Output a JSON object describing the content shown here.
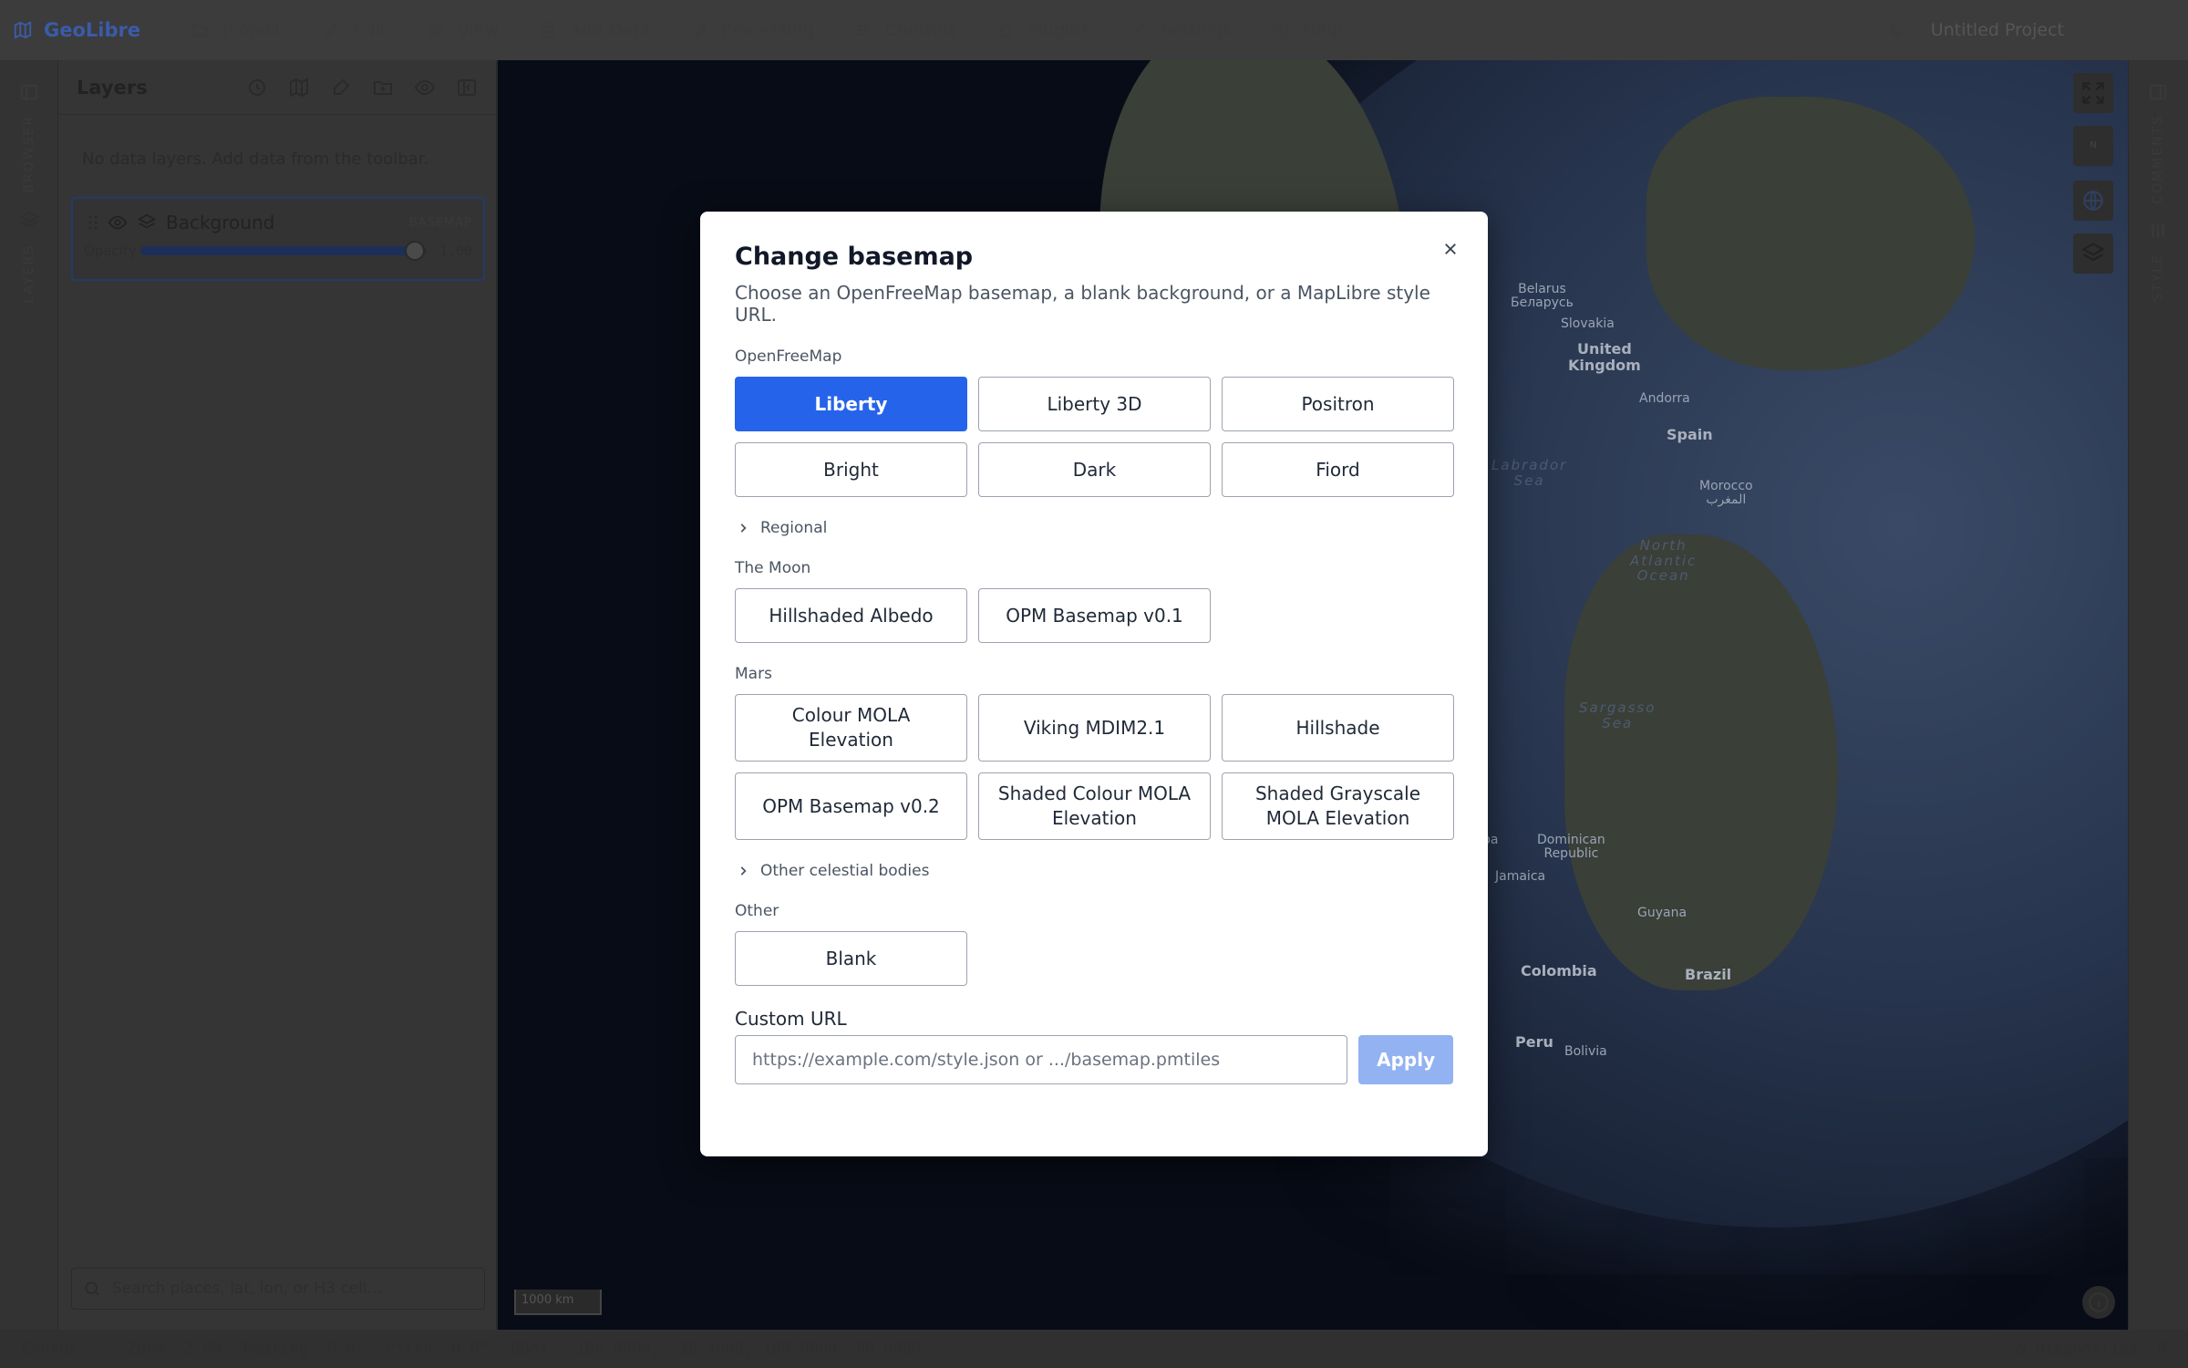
{
  "app": {
    "brand": "GeoLibre",
    "project_title": "Untitled Project"
  },
  "menu": [
    {
      "label": "Project",
      "icon": "folder-icon"
    },
    {
      "label": "Edit",
      "icon": "pencil-icon"
    },
    {
      "label": "View",
      "icon": "eye-icon"
    },
    {
      "label": "Add Data",
      "icon": "database-icon"
    },
    {
      "label": "Processing",
      "icon": "wrench-icon"
    },
    {
      "label": "Controls",
      "icon": "sliders-icon"
    },
    {
      "label": "Plugins",
      "icon": "puzzle-icon"
    },
    {
      "label": "Settings",
      "icon": "gear-icon"
    },
    {
      "label": "Help",
      "icon": "help-icon"
    }
  ],
  "left_rail": {
    "browser": "BROWSER",
    "layers": "LAYERS"
  },
  "right_rail": {
    "comments": "COMMENTS",
    "style": "STYLE"
  },
  "layers_panel": {
    "title": "Layers",
    "empty_message": "No data layers. Add data from the toolbar.",
    "layer": {
      "name": "Background",
      "tag": "BASEMAP",
      "opacity_label": "Opacity",
      "opacity_value": "1.00",
      "opacity_fraction": 1.0
    },
    "search_placeholder": "Search places, lat, lon, or H3 cell..."
  },
  "map": {
    "scale": "1000 km",
    "compass": "N",
    "labels": [
      {
        "text": "Belarus\nБеларусь",
        "cls": ""
      },
      {
        "text": "Slovakia",
        "cls": ""
      },
      {
        "text": "United\nKingdom",
        "cls": "big"
      },
      {
        "text": "Andorra",
        "cls": ""
      },
      {
        "text": "Spain",
        "cls": "big"
      },
      {
        "text": "Labrador\nSea",
        "cls": "sea"
      },
      {
        "text": "Morocco\nالمغرب",
        "cls": ""
      },
      {
        "text": "North\nAtlantic\nOcean",
        "cls": "sea"
      },
      {
        "text": "Sargasso\nSea",
        "cls": "sea"
      },
      {
        "text": "Dominican\nRepublic",
        "cls": ""
      },
      {
        "text": "Jamaica",
        "cls": ""
      },
      {
        "text": "Guyana",
        "cls": ""
      },
      {
        "text": "Colombia",
        "cls": "big"
      },
      {
        "text": "Brazil",
        "cls": "big"
      },
      {
        "text": "Peru",
        "cls": "big"
      },
      {
        "text": "Bolivia",
        "cls": ""
      },
      {
        "text": "ba",
        "cls": ""
      }
    ]
  },
  "status": {
    "coords": "Coords: –",
    "zoom": "Zoom: 2.00",
    "bearing": "Bearing: 0.0°",
    "pitch": "Pitch: 0.0°",
    "bbox": "BBox: -180.0000, -36.4608, 180.0000, 90.0000",
    "diagnostics": "Diagnostics: 0"
  },
  "modal": {
    "title": "Change basemap",
    "description": "Choose an OpenFreeMap basemap, a blank background, or a MapLibre style URL.",
    "openfreemap": {
      "label": "OpenFreeMap",
      "options": [
        "Liberty",
        "Liberty 3D",
        "Positron",
        "Bright",
        "Dark",
        "Fiord"
      ],
      "selected": "Liberty"
    },
    "regional": "Regional",
    "moon": {
      "label": "The Moon",
      "options": [
        "Hillshaded Albedo",
        "OPM Basemap v0.1"
      ]
    },
    "mars": {
      "label": "Mars",
      "options": [
        "Colour MOLA Elevation",
        "Viking MDIM2.1",
        "Hillshade",
        "OPM Basemap v0.2",
        "Shaded Colour MOLA Elevation",
        "Shaded Grayscale MOLA Elevation"
      ]
    },
    "other_bodies": "Other celestial bodies",
    "other": {
      "label": "Other",
      "options": [
        "Blank"
      ]
    },
    "custom_url": {
      "label": "Custom URL",
      "placeholder": "https://example.com/style.json or .../basemap.pmtiles",
      "value": "",
      "apply": "Apply"
    }
  },
  "colors": {
    "accent": "#2563eb",
    "apply_disabled": "#93b2f2",
    "brand": "#3b5ba8"
  }
}
